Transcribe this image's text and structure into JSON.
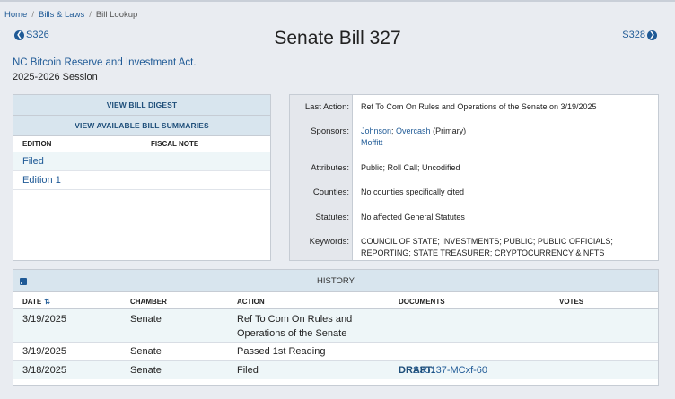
{
  "breadcrumb": [
    "Home",
    "Bills & Laws",
    "Bill Lookup"
  ],
  "nav": {
    "prev": "S326",
    "next": "S328"
  },
  "title": "Senate Bill 327",
  "bill_short_title": "NC Bitcoin Reserve and Investment Act.",
  "session": "2025-2026 Session",
  "left": {
    "view_digest": "VIEW BILL DIGEST",
    "view_summaries": "VIEW AVAILABLE BILL SUMMARIES",
    "col_edition": "EDITION",
    "col_fiscal": "FISCAL NOTE",
    "editions": [
      "Filed",
      "Edition 1"
    ]
  },
  "info": {
    "last_action_label": "Last Action:",
    "last_action": "Ref To Com On Rules and Operations of the Senate on 3/19/2025",
    "sponsors_label": "Sponsors:",
    "sponsor1": "Johnson",
    "sponsor2": "Overcash",
    "primary": "(Primary)",
    "sponsor3": "Moffitt",
    "attributes_label": "Attributes:",
    "attributes": "Public; Roll Call; Uncodified",
    "counties_label": "Counties:",
    "counties": "No counties specifically cited",
    "statutes_label": "Statutes:",
    "statutes": "No affected General Statutes",
    "keywords_label": "Keywords:",
    "keywords_line1": "COUNCIL OF STATE; INVESTMENTS; PUBLIC; PUBLIC OFFICIALS;",
    "keywords_line2": "REPORTING; STATE TREASURER; CRYPTOCURRENCY & NFTS"
  },
  "history": {
    "title": "HISTORY",
    "headers": {
      "date": "DATE",
      "chamber": "CHAMBER",
      "action": "ACTION",
      "documents": "DOCUMENTS",
      "votes": "VOTES"
    },
    "rows": [
      {
        "date": "3/19/2025",
        "chamber": "Senate",
        "action_line1": "Ref To Com On Rules and",
        "action_line2": "Operations of the Senate"
      },
      {
        "date": "3/19/2025",
        "chamber": "Senate",
        "action_line1": "Passed 1st Reading"
      },
      {
        "date": "3/18/2025",
        "chamber": "Senate",
        "action_line1": "Filed",
        "doc_prefix": "DRAFT:",
        "doc_link": "DRS35137-MCxf-60"
      }
    ]
  },
  "colors": {
    "link": "#1f5a96",
    "header_bg": "#d8e5ee",
    "alt_row": "#eef6f8",
    "page_bg": "#e9ecf1"
  },
  "icons": {
    "prev": "chevron-left-circle-icon",
    "next": "chevron-right-circle-icon",
    "rss": "rss-icon",
    "sort": "sort-icon"
  }
}
